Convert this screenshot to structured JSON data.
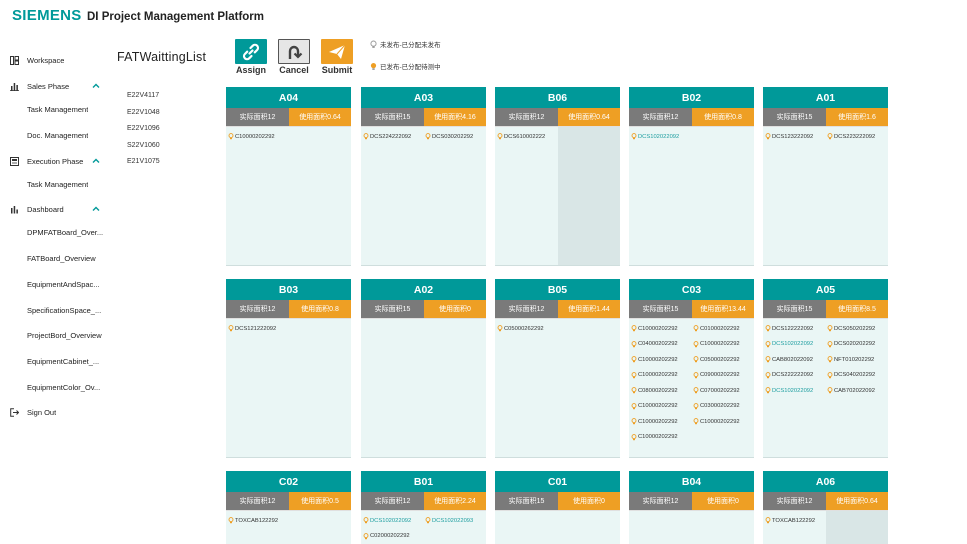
{
  "header": {
    "brand": "SIEMENS",
    "title": "DI Project Management Platform"
  },
  "sidebar": {
    "items": [
      {
        "label": "Workspace",
        "icon": "workspace-icon"
      },
      {
        "label": "Sales Phase",
        "icon": "chart-icon",
        "chevron": true
      },
      {
        "label": "Task Management"
      },
      {
        "label": "Doc. Management"
      },
      {
        "label": "Execution Phase",
        "icon": "execution-icon",
        "chevron": true
      },
      {
        "label": "Task Management"
      },
      {
        "label": "Dashboard",
        "icon": "dashboard-icon",
        "chevron": true
      },
      {
        "label": "DPMFATBoard_Over..."
      },
      {
        "label": "FATBoard_Overview"
      },
      {
        "label": "EquipmentAndSpac..."
      },
      {
        "label": "SpecificationSpace_..."
      },
      {
        "label": "ProjectBord_Overview"
      },
      {
        "label": "EquipmentCabinet_..."
      },
      {
        "label": "EquipmentColor_Ov..."
      },
      {
        "label": "Sign Out",
        "icon": "sign-out-icon"
      }
    ]
  },
  "waitlist": {
    "title": "FATWaittingList",
    "items": [
      "E22V4117",
      "E22V1048",
      "E22V1096",
      "S22V1060",
      "E21V1075"
    ]
  },
  "toolbar": {
    "assign_label": "Assign",
    "cancel_label": "Cancel",
    "submit_label": "Submit"
  },
  "legend": {
    "unpublished": "未发布-已分配未发布",
    "published": "已发布-已分配待测中"
  },
  "colors": {
    "accent": "#009999",
    "orange": "#ee9f24",
    "gray": "#7a7a7a",
    "card_bg": "#eaf6f5"
  },
  "cards": [
    {
      "name": "A04",
      "actual": "实际面积12",
      "used": "使用面积0.64",
      "items": [
        {
          "t": "C10000202292"
        }
      ],
      "shade": 0
    },
    {
      "name": "A03",
      "actual": "实际面积15",
      "used": "使用面积4.16",
      "items": [
        {
          "t": "DCS224222092"
        },
        {
          "t": "DCS030202292"
        }
      ],
      "shade": 0
    },
    {
      "name": "B06",
      "actual": "实际面积12",
      "used": "使用面积0.64",
      "items": [
        {
          "t": "DCS610002222"
        }
      ],
      "shade": 62
    },
    {
      "name": "B02",
      "actual": "实际面积12",
      "used": "使用面积0.8",
      "items": [
        {
          "t": "DCS102022092",
          "teal": true
        }
      ],
      "shade": 0
    },
    {
      "name": "A01",
      "actual": "实际面积15",
      "used": "使用面积1.6",
      "items": [
        {
          "t": "DCS123222092"
        },
        {
          "t": "DCS223222092"
        }
      ],
      "shade": 0
    },
    {
      "name": "B03",
      "actual": "实际面积12",
      "used": "使用面积0.8",
      "items": [
        {
          "t": "DCS121222092"
        }
      ],
      "shade": 0
    },
    {
      "name": "A02",
      "actual": "实际面积15",
      "used": "使用面积0",
      "items": [],
      "shade": 0
    },
    {
      "name": "B05",
      "actual": "实际面积12",
      "used": "使用面积1.44",
      "items": [
        {
          "t": "C05000262292"
        }
      ],
      "shade": 0
    },
    {
      "name": "C03",
      "actual": "实际面积15",
      "used": "使用面积13.44",
      "items": [
        {
          "t": "C10000202292"
        },
        {
          "t": "C01000202292"
        },
        {
          "t": "C04000202292"
        },
        {
          "t": "C10000202292"
        },
        {
          "t": "C10000202292"
        },
        {
          "t": "C05000202292"
        },
        {
          "t": "C10000202292"
        },
        {
          "t": "C09000202292"
        },
        {
          "t": "C08000202292"
        },
        {
          "t": "C07000202292"
        },
        {
          "t": "C10000202292"
        },
        {
          "t": "C03000202292"
        },
        {
          "t": "C10000202292"
        },
        {
          "t": "C10000202292"
        },
        {
          "t": "C10000202292"
        }
      ],
      "shade": 0
    },
    {
      "name": "A05",
      "actual": "实际面积15",
      "used": "使用面积8.5",
      "items": [
        {
          "t": "DCS122222092"
        },
        {
          "t": "DCS050202292"
        },
        {
          "t": "DCS102022092",
          "teal": true
        },
        {
          "t": "DCS020202292"
        },
        {
          "t": "CAB802022092"
        },
        {
          "t": "NFT010202292"
        },
        {
          "t": "DCS222222092"
        },
        {
          "t": "DCS040202292"
        },
        {
          "t": "DCS102022092",
          "teal": true
        },
        {
          "t": "CAB702022092"
        }
      ],
      "shade": 0
    },
    {
      "name": "C02",
      "actual": "实际面积12",
      "used": "使用面积0.5",
      "items": [
        {
          "t": "TOXCAB122292"
        }
      ],
      "shade": 0
    },
    {
      "name": "B01",
      "actual": "实际面积12",
      "used": "使用面积2.24",
      "items": [
        {
          "t": "DCS102022092",
          "teal": true
        },
        {
          "t": "DCS102022093",
          "teal": true
        },
        {
          "t": "C02000202292"
        }
      ],
      "shade": 0
    },
    {
      "name": "C01",
      "actual": "实际面积15",
      "used": "使用面积0",
      "items": [],
      "shade": 0
    },
    {
      "name": "B04",
      "actual": "实际面积12",
      "used": "使用面积0",
      "items": [],
      "shade": 0
    },
    {
      "name": "A06",
      "actual": "实际面积12",
      "used": "使用面积0.64",
      "items": [
        {
          "t": "TOXCAB122292"
        }
      ],
      "shade": 62
    }
  ]
}
